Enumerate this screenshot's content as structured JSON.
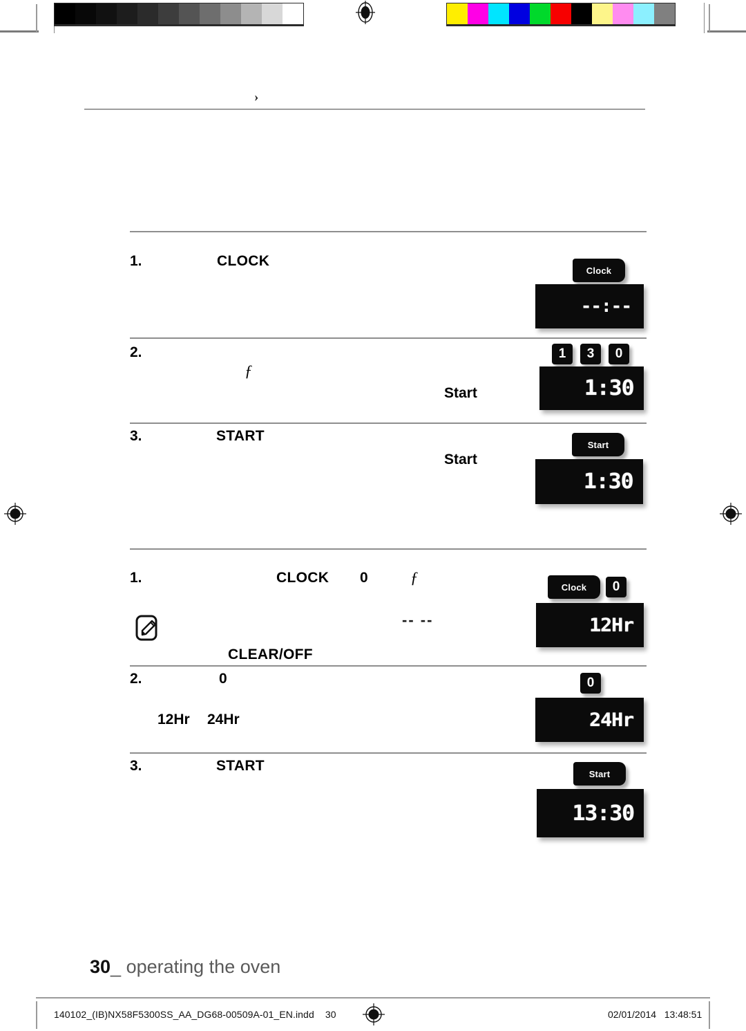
{
  "prepress": {
    "grayscale_swatches": [
      "#000000",
      "#080808",
      "#111111",
      "#1d1d1d",
      "#2b2b2b",
      "#3d3d3d",
      "#545454",
      "#6e6e6e",
      "#8d8d8d",
      "#b4b4b4",
      "#d8d8d8",
      "#ffffff"
    ],
    "color_swatches": [
      "#ffee00",
      "#ff00e6",
      "#00e5ff",
      "#0000e0",
      "#00d92b",
      "#f70000",
      "#000000",
      "#fdf58a",
      "#ff8cf0",
      "#8cf0ff",
      "#808080"
    ],
    "registration_mark": "registration-target"
  },
  "header": {
    "chevron": "›"
  },
  "sections": [
    {
      "id": "set-clock",
      "steps": [
        {
          "number": "1.",
          "keyword": "CLOCK",
          "keys": [
            {
              "type": "word",
              "label": "Clock"
            }
          ],
          "display": "--:--",
          "display_kind": "dashes"
        },
        {
          "number": "2.",
          "keyword": "",
          "italic_marker": "ƒ",
          "inline_label": "Start",
          "keys": [
            {
              "type": "num",
              "label": "1"
            },
            {
              "type": "num",
              "label": "3"
            },
            {
              "type": "num",
              "label": "0"
            }
          ],
          "display": "1:30",
          "display_kind": "time"
        },
        {
          "number": "3.",
          "keyword": "START",
          "inline_label": "Start",
          "keys": [
            {
              "type": "word",
              "label": "Start"
            }
          ],
          "display": "1:30",
          "display_kind": "time"
        }
      ]
    },
    {
      "id": "set-clock-mode",
      "steps": [
        {
          "number": "1.",
          "keyword": "CLOCK",
          "inline_zero": "0",
          "italic_marker": "ƒ",
          "note_icon": "note-pencil-icon",
          "note_dashes": "-- --",
          "note_keyword": "CLEAR/OFF",
          "keys": [
            {
              "type": "word",
              "label": "Clock"
            },
            {
              "type": "num",
              "label": "0"
            }
          ],
          "display": "12Hr",
          "display_kind": "mode"
        },
        {
          "number": "2.",
          "inline_zero": "0",
          "option_a": "12Hr",
          "option_b": "24Hr",
          "keys": [
            {
              "type": "num",
              "label": "0"
            }
          ],
          "display": "24Hr",
          "display_kind": "mode"
        },
        {
          "number": "3.",
          "keyword": "START",
          "keys": [
            {
              "type": "word",
              "label": "Start"
            }
          ],
          "display": "13:30",
          "display_kind": "time"
        }
      ]
    }
  ],
  "footer": {
    "page_number": "30",
    "separator": "_",
    "title": "operating the oven"
  },
  "slug": {
    "filename": "140102_(IB)NX58F5300SS_AA_DG68-00509A-01_EN.indd",
    "page": "30",
    "date": "02/01/2014",
    "time": "13:48:51"
  }
}
